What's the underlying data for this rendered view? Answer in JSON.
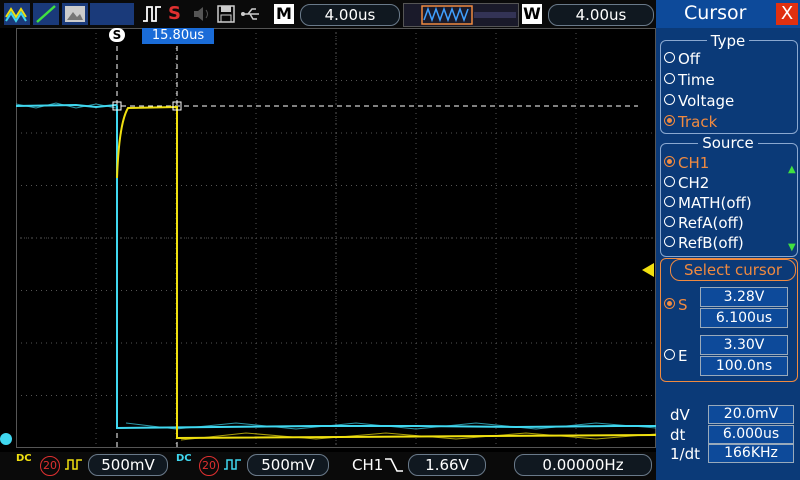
{
  "top": {
    "mode_letter": "M",
    "timebase": "4.00us",
    "window_letter": "W",
    "window_timebase": "4.00us",
    "stop_label": "S"
  },
  "cursor_labels": {
    "start_marker": "S",
    "delta_time": "15.80us"
  },
  "panel": {
    "title": "Cursor",
    "close": "X",
    "type_title": "Type",
    "type_options": [
      {
        "label": "Off"
      },
      {
        "label": "Time"
      },
      {
        "label": "Voltage"
      },
      {
        "label": "Track"
      }
    ],
    "selected_type": "Track",
    "source_title": "Source",
    "source_options": [
      {
        "label": "CH1"
      },
      {
        "label": "CH2"
      },
      {
        "label": "MATH(off)"
      },
      {
        "label": "RefA(off)"
      },
      {
        "label": "RefB(off)"
      }
    ],
    "selected_source": "CH1",
    "select_cursor_title": "Select cursor",
    "cursor_s": {
      "label": "S",
      "voltage": "3.28V",
      "time": "6.100us"
    },
    "cursor_e": {
      "label": "E",
      "voltage": "3.30V",
      "time": "100.0ns"
    },
    "measurements": {
      "dv_label": "dV",
      "dv_value": "20.0mV",
      "dt_label": "dt",
      "dt_value": "6.000us",
      "inv_label": "1/dt",
      "inv_value": "166KHz"
    }
  },
  "bottom": {
    "ch1_coupling": "DC",
    "ch1_bw": "20",
    "ch1_scale": "500mV",
    "ch2_coupling": "DC",
    "ch2_bw": "20",
    "ch2_scale": "500mV",
    "trigger_source": "CH1",
    "trigger_level": "1.66V",
    "frequency": "0.00000Hz"
  },
  "colors": {
    "ch1": "#f0e010",
    "ch2": "#40d8f0",
    "panel_bg": "#0b3a78",
    "accent_orange": "#f08a40",
    "cursor_label_bg": "#1a6cd8"
  }
}
